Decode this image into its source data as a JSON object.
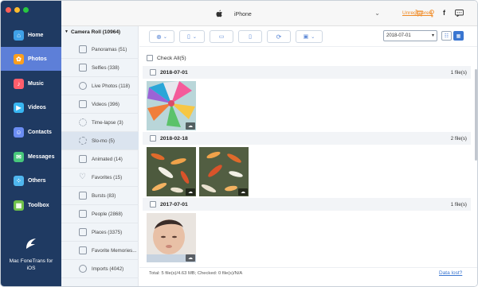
{
  "nav": {
    "items": [
      {
        "label": "Home",
        "icon": "home-icon",
        "color": "#3fa1e8"
      },
      {
        "label": "Photos",
        "icon": "photos-icon",
        "color": "#ff9f1c"
      },
      {
        "label": "Music",
        "icon": "music-icon",
        "color": "#ff5e6c"
      },
      {
        "label": "Videos",
        "icon": "videos-icon",
        "color": "#38b6f2"
      },
      {
        "label": "Contacts",
        "icon": "contacts-icon",
        "color": "#6b8df3"
      },
      {
        "label": "Messages",
        "icon": "messages-icon",
        "color": "#47c77b"
      },
      {
        "label": "Others",
        "icon": "others-icon",
        "color": "#4fb6ee"
      },
      {
        "label": "Toolbox",
        "icon": "toolbox-icon",
        "color": "#6fc14a"
      }
    ],
    "active": "Photos",
    "brand_line1": "Mac FoneTrans for",
    "brand_line2": "iOS"
  },
  "topbar": {
    "device_name": "iPhone",
    "unregistered": "Unregistered"
  },
  "categories": {
    "header": "Camera Roll (10964)",
    "items": [
      {
        "label": "Panoramas (51)"
      },
      {
        "label": "Selfies (338)"
      },
      {
        "label": "Live Photos (118)"
      },
      {
        "label": "Videos (396)"
      },
      {
        "label": "Time-lapse (3)"
      },
      {
        "label": "Slo-mo (5)"
      },
      {
        "label": "Animated (14)"
      },
      {
        "label": "Favorites (15)"
      },
      {
        "label": "Bursts (83)"
      },
      {
        "label": "People (2868)"
      },
      {
        "label": "Places (3375)"
      },
      {
        "label": "Favorite Memories..."
      },
      {
        "label": "Imports (4042)"
      }
    ],
    "active": "Slo-mo (5)"
  },
  "toolbar": {
    "date_value": "2018-07-01"
  },
  "content": {
    "check_all": "Check All(5)",
    "groups": [
      {
        "date": "2018-07-01",
        "count": "1 file(s)"
      },
      {
        "date": "2018-02-18",
        "count": "2 file(s)"
      },
      {
        "date": "2017-07-01",
        "count": "1 file(s)"
      }
    ]
  },
  "status": {
    "summary": "Total: 5 file(s)/4.63 MB; Checked: 0 file(s)/N/A",
    "data_lost": "Data lost?"
  },
  "colors": {
    "nav_bg": "#1f3a62",
    "nav_active": "#5d7fd8",
    "accent": "#3a76d1",
    "warning": "#f08a24"
  }
}
